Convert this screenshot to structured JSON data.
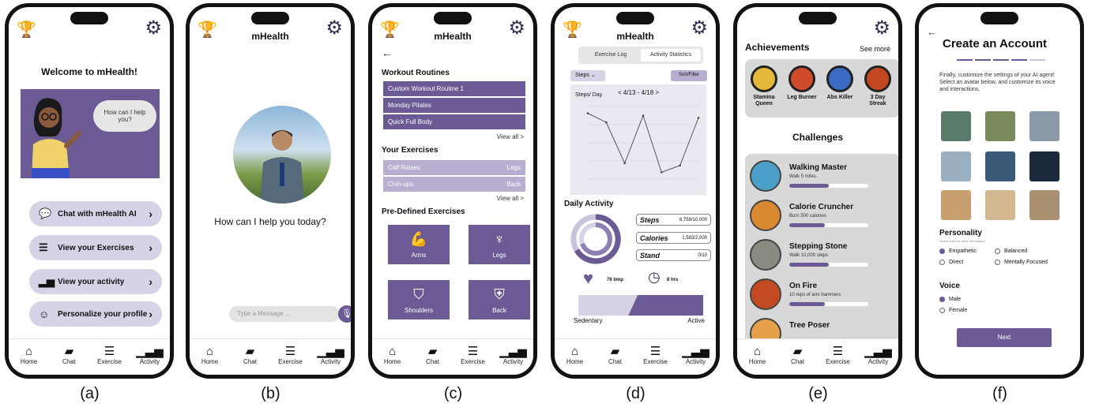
{
  "captions": [
    "(a)",
    "(b)",
    "(c)",
    "(d)",
    "(e)",
    "(f)"
  ],
  "app_name": "mHealth",
  "icons": {
    "trophy": "trophy-icon",
    "gear": "gear-icon",
    "back": "back-arrow-icon",
    "mic": "microphone-icon"
  },
  "colors": {
    "accent": "#6b5a94",
    "accent_light": "#b7aed0",
    "accent_pale": "#d8d2e6"
  },
  "tabbar": [
    {
      "label": "Home",
      "icon": "home-icon"
    },
    {
      "label": "Chat",
      "icon": "chat-icon"
    },
    {
      "label": "Exercise",
      "icon": "list-icon"
    },
    {
      "label": "Activity",
      "icon": "activity-chart-icon"
    }
  ],
  "screen_a": {
    "title": "Welcome to mHealth!",
    "bubble": "How can I help you?",
    "buttons": [
      {
        "label": "Chat with mHealth AI",
        "icon": "chat-icon"
      },
      {
        "label": "View your Exercises",
        "icon": "list-icon"
      },
      {
        "label": "View your activity",
        "icon": "activity-chart-icon"
      },
      {
        "label": "Personalize your profile",
        "icon": "profile-settings-icon"
      }
    ]
  },
  "screen_b": {
    "question": "How can I help you today?",
    "input_placeholder": "Type a Message ..."
  },
  "screen_c": {
    "routines_title": "Workout Routines",
    "routines": [
      "Custom Workout Routine 1",
      "Monday Pilates",
      "Quick Full Body"
    ],
    "view_all": "View all >",
    "exercises_title": "Your Exercises",
    "exercises": [
      {
        "name": "Calf Raises",
        "group": "Legs"
      },
      {
        "name": "Chin-ups",
        "group": "Back"
      }
    ],
    "predefined_title": "Pre-Defined Exercises",
    "predefined": [
      {
        "label": "Arms",
        "icon": "arm-icon"
      },
      {
        "label": "Legs",
        "icon": "leg-icon"
      },
      {
        "label": "Shoulders",
        "icon": "shoulders-icon"
      },
      {
        "label": "Back",
        "icon": "back-muscle-icon"
      }
    ]
  },
  "screen_d": {
    "toggle": [
      "Exercise Log",
      "Activity Statistics"
    ],
    "select": "Steps",
    "sort": "Sort/Filter",
    "chart_title": "Steps/ Day",
    "chart_range": "< 4/13 - 4/18 >",
    "daily_title": "Daily Activity",
    "stats": [
      {
        "label": "Steps",
        "value": "6,758/10,000"
      },
      {
        "label": "Calories",
        "value": "1,583/2,000"
      },
      {
        "label": "Stand",
        "value": "0/10"
      }
    ],
    "heart": "76 bmp",
    "sleep": "8 hrs",
    "bar_left": "Sedentary",
    "bar_right": "Active",
    "bar_fill": 0.6
  },
  "chart_data": {
    "type": "line",
    "title": "Steps/ Day",
    "values": [
      14500,
      12500,
      3500,
      14000,
      1500,
      3000,
      13500
    ]
  },
  "screen_e": {
    "achievements_title": "Achievements",
    "see_more": "See more",
    "badges": [
      {
        "label": "Stamina Queen",
        "icon": "crown-badge-icon"
      },
      {
        "label": "Leg Burner",
        "icon": "flame-badge-icon"
      },
      {
        "label": "Abs Killer",
        "icon": "robot-badge-icon"
      },
      {
        "label": "3 Day Streak",
        "icon": "streak-badge-icon"
      }
    ],
    "challenges_title": "Challenges",
    "challenges": [
      {
        "title": "Walking Master",
        "sub": "Walk 5 miles",
        "progress": 0.5
      },
      {
        "title": "Calorie Cruncher",
        "sub": "Burn 500 calories",
        "progress": 0.45
      },
      {
        "title": "Stepping Stone",
        "sub": "Walk 10,000 steps",
        "progress": 0.5
      },
      {
        "title": "On Fire",
        "sub": "10 reps of arm hammers",
        "progress": 0.45
      },
      {
        "title": "Tree Poser",
        "sub": "",
        "progress": 0.4
      }
    ]
  },
  "screen_f": {
    "title": "Create an Account",
    "intro": "Finally, customize the settings of your AI agent! Select an avatar below, and customize its voice and interactions.",
    "personality_title": "Personality",
    "personality_sub": "Select each for more information",
    "personality": [
      {
        "label": "Empathetic",
        "selected": true
      },
      {
        "label": "Balanced",
        "selected": false
      },
      {
        "label": "Direct",
        "selected": false
      },
      {
        "label": "Mentally Focused",
        "selected": false
      }
    ],
    "voice_title": "Voice",
    "voice": [
      {
        "label": "Male",
        "selected": true
      },
      {
        "label": "Female",
        "selected": false
      }
    ],
    "next": "Next"
  }
}
